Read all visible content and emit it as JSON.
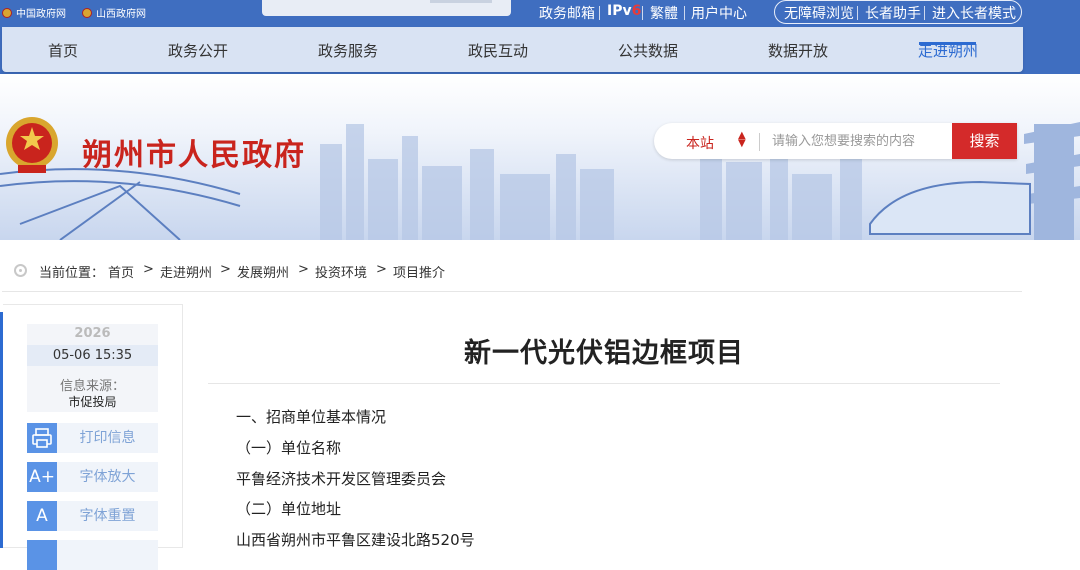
{
  "top": {
    "links": [
      "中国政府网",
      "山西政府网"
    ],
    "right_links": [
      "政务邮箱",
      "IPv6",
      "繁體",
      "用户中心"
    ],
    "ipv6_accent": "6",
    "accessibility": [
      "无障碍浏览",
      "长者助手",
      "进入长者模式"
    ]
  },
  "nav": {
    "items": [
      "首页",
      "政务公开",
      "政务服务",
      "政民互动",
      "公共数据",
      "数据开放",
      "走进朔州"
    ],
    "active_index": 6
  },
  "banner": {
    "site_name": "朔州市人民政府",
    "search_scope": "本站",
    "search_placeholder": "请输入您想要搜索的内容",
    "search_button": "搜索"
  },
  "breadcrumb": {
    "label": "当前位置：",
    "items": [
      "首页",
      "走进朔州",
      "发展朔州",
      "投资环境",
      "项目推介"
    ],
    "separator": ">"
  },
  "sidebar": {
    "year": "2026",
    "month_day": "05-06 15:35",
    "source_label": "信息来源：",
    "source_value": "市促投局",
    "tools": [
      {
        "icon": "printer-icon",
        "label": "打印信息"
      },
      {
        "icon": "font-enlarge-icon",
        "glyph": "A+",
        "label": "字体放大"
      },
      {
        "icon": "font-reset-icon",
        "glyph": "A",
        "label": "字体重置"
      }
    ]
  },
  "article": {
    "title": "新一代光伏铝边框项目",
    "paragraphs": [
      "一、招商单位基本情况",
      "（一）单位名称",
      "平鲁经济技术开发区管理委员会",
      "（二）单位地址",
      "山西省朔州市平鲁区建设北路520号"
    ]
  },
  "colors": {
    "primary": "#3f6ec0",
    "accent_red": "#c9241d",
    "nav_bg": "#d9e3f3",
    "active_blue": "#2d6bd1"
  }
}
